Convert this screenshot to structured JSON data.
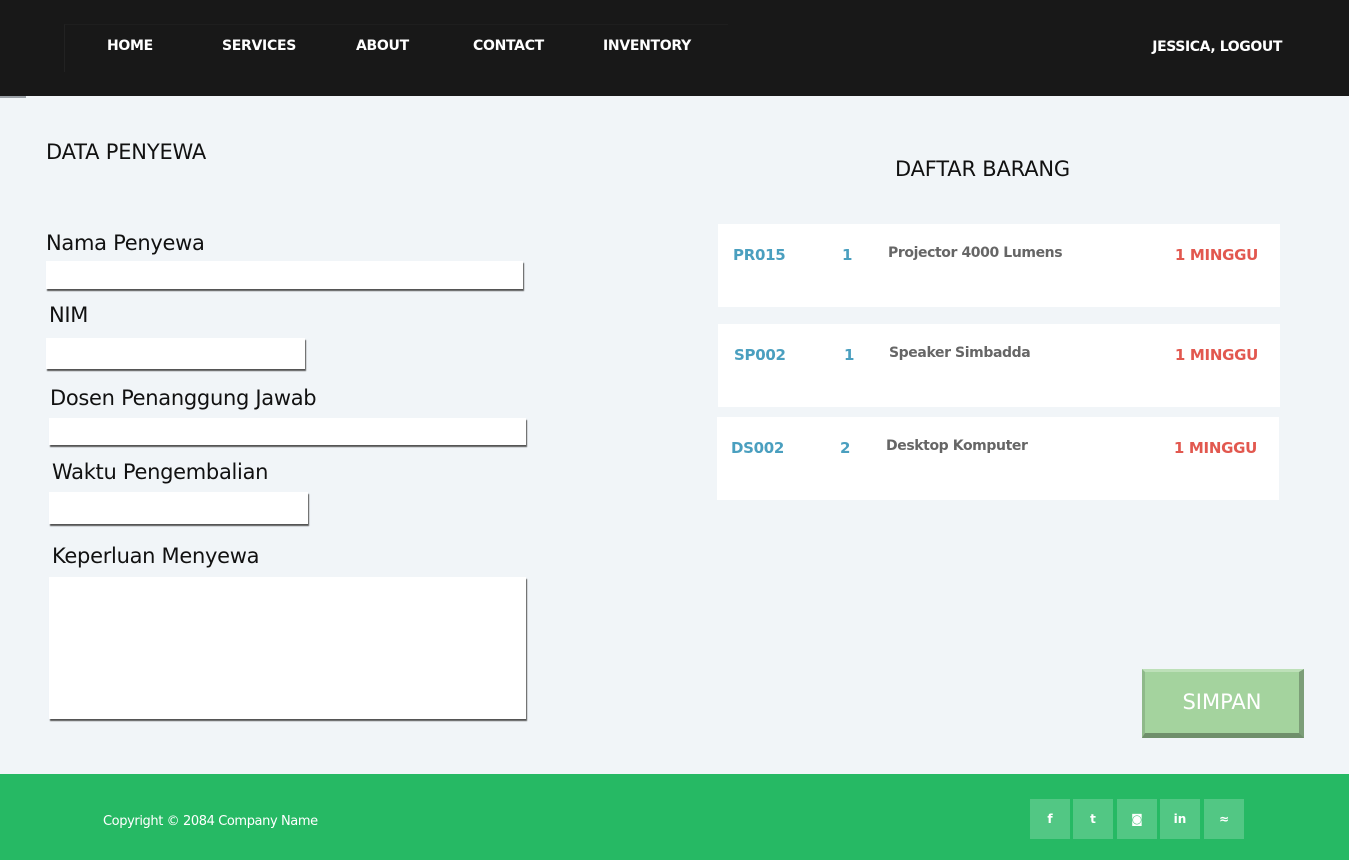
{
  "nav": {
    "links": [
      "HOME",
      "SERVICES",
      "ABOUT",
      "CONTACT",
      "INVENTORY"
    ],
    "user": "JESSICA, LOGOUT"
  },
  "form": {
    "title": "DATA PENYEWA",
    "fields": [
      {
        "label": "Nama Penyewa",
        "value": ""
      },
      {
        "label": "NIM",
        "value": ""
      },
      {
        "label": "Dosen Penanggung Jawab",
        "value": ""
      },
      {
        "label": "Waktu Pengembalian",
        "value": ""
      },
      {
        "label": "Keperluan Menyewa",
        "value": ""
      }
    ]
  },
  "items": {
    "title": "DAFTAR BARANG",
    "list": [
      {
        "code": "PR015",
        "qty": "1",
        "name": "Projector 4000 Lumens",
        "duration": "1 MINGGU"
      },
      {
        "code": "SP002",
        "qty": "1",
        "name": "Speaker Simbadda",
        "duration": "1 MINGGU"
      },
      {
        "code": "DS002",
        "qty": "2",
        "name": "Desktop Komputer",
        "duration": "1 MINGGU"
      }
    ]
  },
  "save_label": "SIMPAN",
  "footer": {
    "copyright": "Copyright © 2084 Company Name",
    "social": [
      {
        "icon": "facebook-icon",
        "glyph": "f"
      },
      {
        "icon": "twitter-icon",
        "glyph": "t"
      },
      {
        "icon": "instagram-icon",
        "glyph": "◙"
      },
      {
        "icon": "linkedin-icon",
        "glyph": "in"
      },
      {
        "icon": "rss-icon",
        "glyph": "≈"
      }
    ]
  }
}
